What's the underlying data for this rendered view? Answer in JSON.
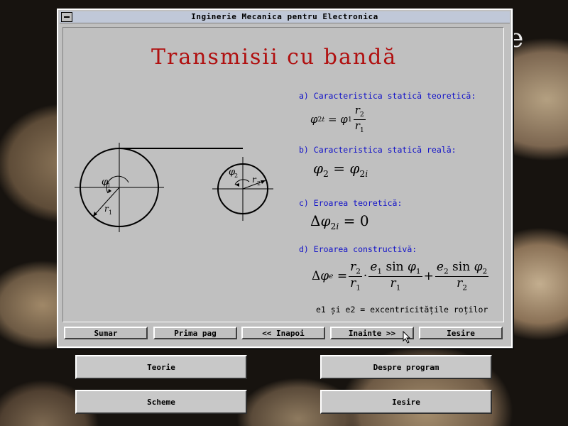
{
  "background": {
    "partial_letter": "e"
  },
  "window": {
    "title": "Inginerie Mecanica pentru Electronica"
  },
  "slide": {
    "title": "Transmisii cu bandă",
    "sections": {
      "a": "a) Caracteristica statică teoretică:",
      "b": "b) Caracteristica statică reală:",
      "c": "c) Eroarea teoretică:",
      "d": "d) Eroarea constructivă:"
    },
    "note": "e1 și e2 = excentricitățile roților",
    "formula_c_value": "0"
  },
  "nav": {
    "sumar": "Sumar",
    "prima_pag": "Prima pag",
    "inapoi": "<< Inapoi",
    "inainte": "Inainte >>",
    "iesire": "Iesire"
  },
  "main_menu": {
    "teorie": "Teorie",
    "despre": "Despre program",
    "scheme": "Scheme",
    "iesire": "Iesire"
  },
  "colors": {
    "title_red": "#b01010",
    "label_blue": "#1010c8"
  }
}
